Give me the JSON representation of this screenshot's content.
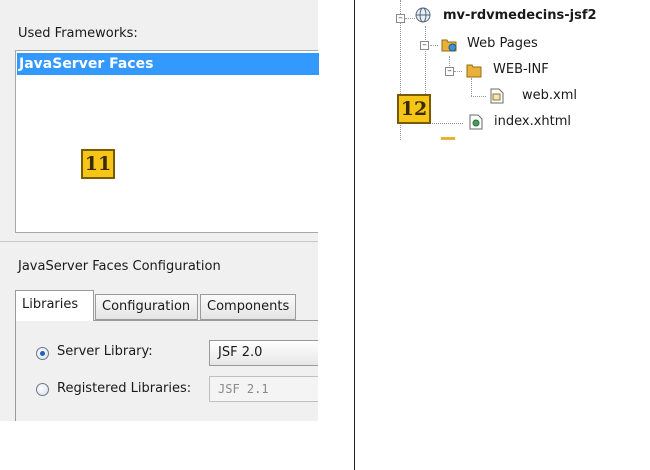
{
  "dialog": {
    "used_frameworks_label": "Used Frameworks:",
    "frameworks": [
      {
        "label": "JavaServer Faces",
        "selected": true
      }
    ],
    "config_section_label": "JavaServer Faces Configuration",
    "tabs": [
      {
        "label": "Libraries",
        "active": true
      },
      {
        "label": "Configuration",
        "active": false
      },
      {
        "label": "Components",
        "active": false
      }
    ],
    "server_library": {
      "label": "Server Library:",
      "selected": true,
      "value": "JSF 2.0"
    },
    "registered_libraries": {
      "label": "Registered Libraries:",
      "selected": false,
      "value": "JSF 2.1"
    }
  },
  "markers": {
    "left": "11",
    "right": "12"
  },
  "tree": {
    "project": "mv-rdvmedecins-jsf2",
    "web_pages": "Web Pages",
    "web_inf": "WEB-INF",
    "web_xml": "web.xml",
    "index": "index.xhtml"
  },
  "colors": {
    "selection": "#3399ff",
    "marker": "#f5c518",
    "folder": "#e8b23a"
  },
  "icons": [
    "globe-project-icon",
    "web-pages-folder-icon",
    "folder-icon",
    "xml-file-icon",
    "xhtml-file-icon"
  ]
}
